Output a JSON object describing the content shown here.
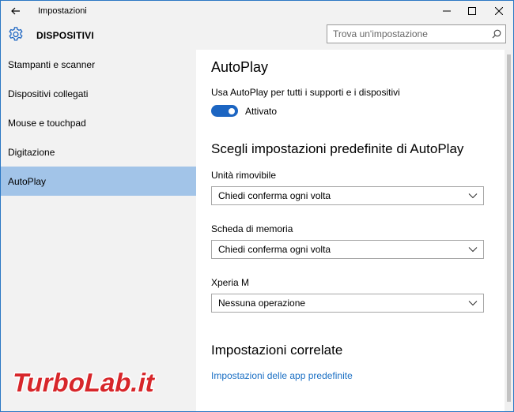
{
  "window": {
    "title": "Impostazioni"
  },
  "header": {
    "title": "DISPOSITIVI",
    "search_placeholder": "Trova un'impostazione"
  },
  "sidebar": {
    "items": [
      {
        "label": "Stampanti e scanner"
      },
      {
        "label": "Dispositivi collegati"
      },
      {
        "label": "Mouse e touchpad"
      },
      {
        "label": "Digitazione"
      },
      {
        "label": "AutoPlay",
        "active": true
      }
    ]
  },
  "main": {
    "heading": "AutoPlay",
    "toggle_caption": "Usa AutoPlay per tutti i supporti e i dispositivi",
    "toggle_state": "Attivato",
    "defaults_heading": "Scegli impostazioni predefinite di AutoPlay",
    "settings": [
      {
        "label": "Unità rimovibile",
        "value": "Chiedi conferma ogni volta"
      },
      {
        "label": "Scheda di memoria",
        "value": "Chiedi conferma ogni volta"
      },
      {
        "label": "Xperia M",
        "value": "Nessuna operazione"
      }
    ],
    "related_heading": "Impostazioni correlate",
    "related_link": "Impostazioni delle app predefinite"
  },
  "watermark": {
    "text": "TurboLab.it"
  },
  "colors": {
    "accent": "#1c65c2",
    "sidebar_selected": "#a2c4e8",
    "link": "#1a6fc4",
    "logo_red": "#d7262a"
  }
}
